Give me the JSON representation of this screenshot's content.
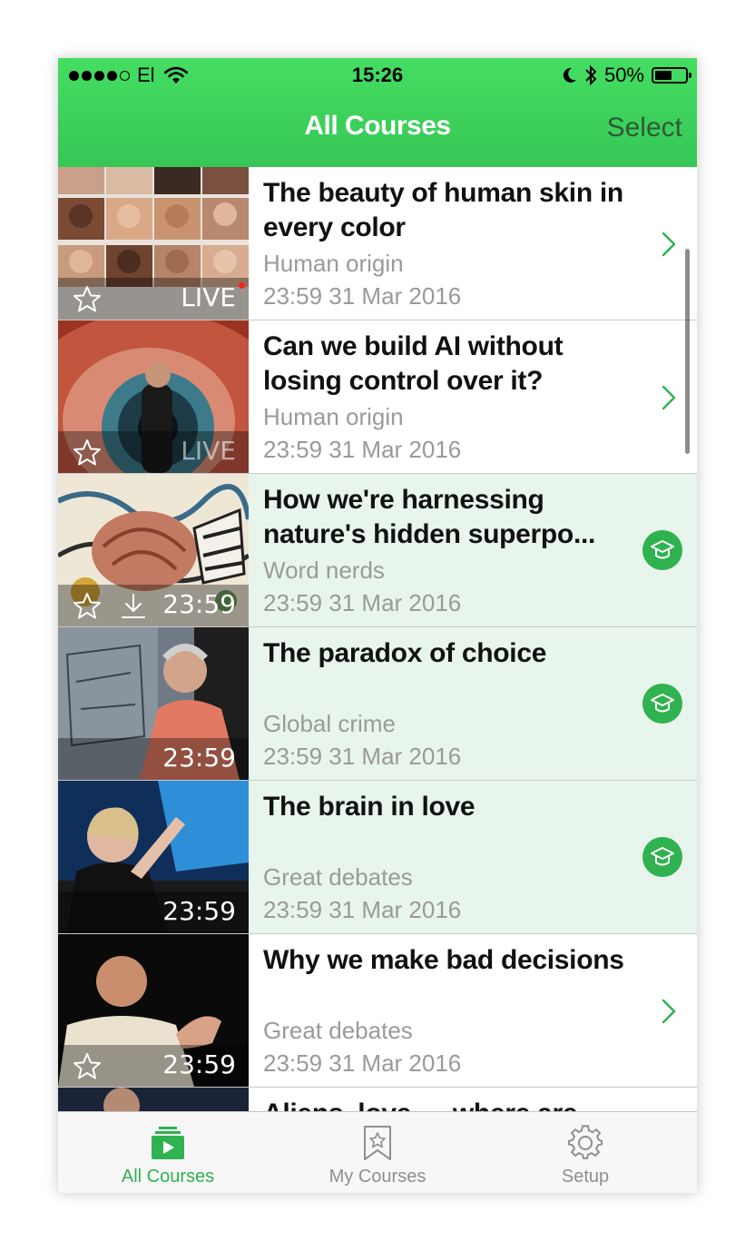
{
  "status_bar": {
    "carrier": "El",
    "time": "15:26",
    "battery": "50%",
    "signal_bars": 4,
    "battery_level": 0.5
  },
  "header": {
    "title": "All Courses",
    "select_label": "Select"
  },
  "courses": [
    {
      "title": "The beauty of human skin in every color",
      "category": "Human origin",
      "date": "23:59 31 Mar 2016",
      "badge": "LIVE",
      "state": "chevron"
    },
    {
      "title": "Can we build AI without losing control over it?",
      "category": "Human origin",
      "date": "23:59 31 Mar 2016",
      "badge": "LIVE",
      "state": "chevron"
    },
    {
      "title": "How we're harnessing nature's hidden superpo...",
      "category": "Word nerds",
      "date": "23:59 31 Mar 2016",
      "badge": "23:59",
      "state": "completed"
    },
    {
      "title": "The paradox of choice",
      "category": "Global crime",
      "date": "23:59 31 Mar 2016",
      "badge": "23:59",
      "state": "completed"
    },
    {
      "title": "The brain in love",
      "category": "Great debates",
      "date": "23:59 31 Mar 2016",
      "badge": "23:59",
      "state": "completed"
    },
    {
      "title": "Why we make bad decisions",
      "category": "Great debates",
      "date": "23:59 31 Mar 2016",
      "badge": "23:59",
      "state": "chevron"
    },
    {
      "title": "Aliens, love — where are"
    }
  ],
  "tabs": [
    {
      "label": "All Courses",
      "icon": "play-box-icon",
      "active": true
    },
    {
      "label": "My Courses",
      "icon": "bookmark-star-icon",
      "active": false
    },
    {
      "label": "Setup",
      "icon": "gear-icon",
      "active": false
    }
  ],
  "colors": {
    "accent": "#2fb24f",
    "header_top": "#44de62",
    "header_bottom": "#37c656",
    "select_text": "#2d5a35",
    "completed_row": "#e8f5ec"
  }
}
